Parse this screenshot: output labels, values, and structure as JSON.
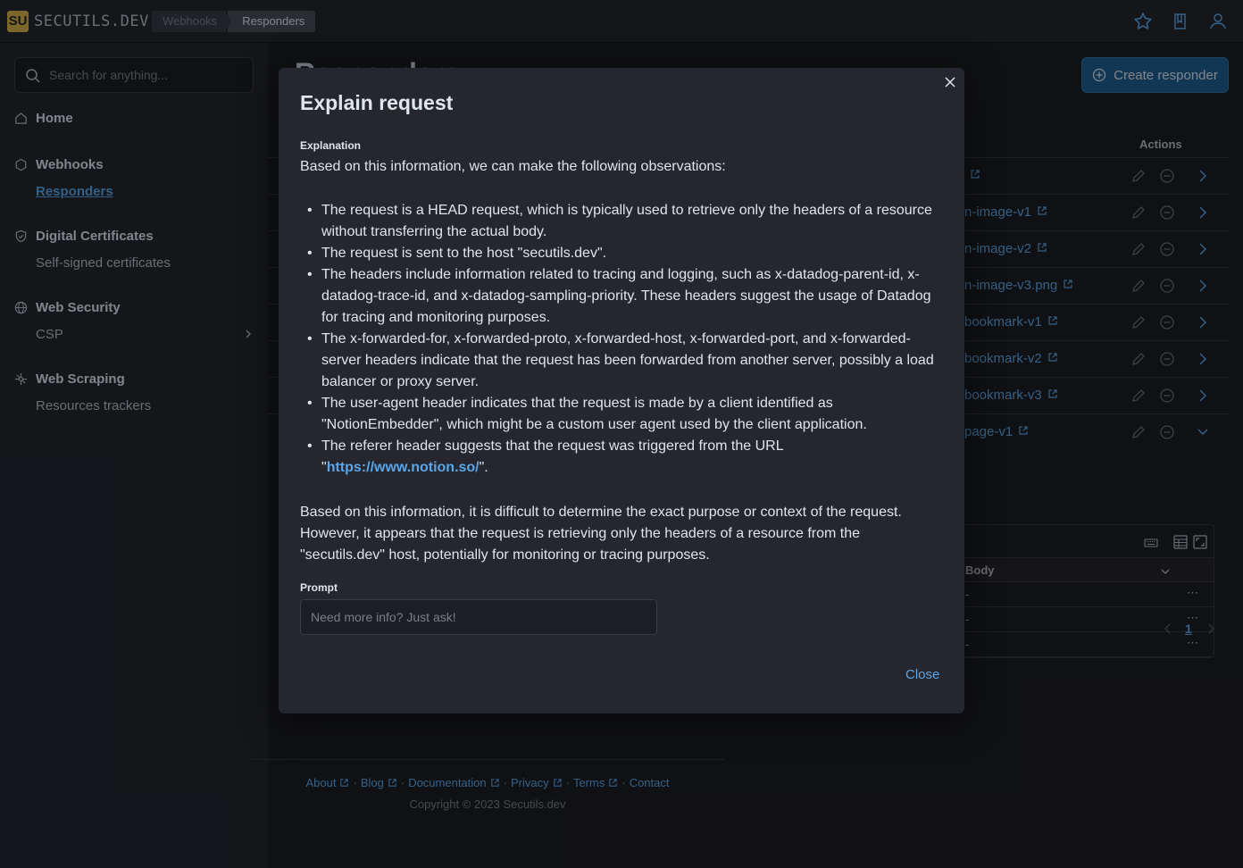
{
  "topbar": {
    "logo_badge": "SU",
    "logo_text": "SECUTILS.DEV",
    "breadcrumbs": [
      "Webhooks",
      "Responders"
    ],
    "icons": [
      "star-icon",
      "book-icon",
      "user-icon"
    ]
  },
  "sidebar": {
    "search_placeholder": "Search for anything...",
    "home": "Home",
    "webhooks": "Webhooks",
    "responders": "Responders",
    "digital_certificates": "Digital Certificates",
    "self_signed": "Self-signed certificates",
    "web_security": "Web Security",
    "csp": "CSP",
    "web_scraping": "Web Scraping",
    "resources_trackers": "Resources trackers"
  },
  "main": {
    "page_title": "Responders",
    "create_button": "Create responder",
    "actions_header": "Actions",
    "rows": [
      {
        "name": ""
      },
      {
        "name": "n-image-v1"
      },
      {
        "name": "n-image-v2"
      },
      {
        "name": "n-image-v3.png"
      },
      {
        "name": "bookmark-v1"
      },
      {
        "name": "bookmark-v2"
      },
      {
        "name": "bookmark-v3"
      },
      {
        "name": "page-v1"
      }
    ],
    "sub_table": {
      "header": "Body",
      "rows": [
        "-",
        "-",
        "-"
      ]
    },
    "pager_current": "1"
  },
  "footer": {
    "links": [
      "About",
      "Blog",
      "Documentation",
      "Privacy",
      "Terms",
      "Contact"
    ],
    "copyright": "Copyright © 2023 Secutils.dev"
  },
  "modal": {
    "title": "Explain request",
    "explanation_label": "Explanation",
    "intro": "Based on this information, we can make the following observations:",
    "bullets": [
      "The request is a HEAD request, which is typically used to retrieve only the headers of a resource without transferring the actual body.",
      "The request is sent to the host \"secutils.dev\".",
      "The headers include information related to tracing and logging, such as x-datadog-parent-id, x-datadog-trace-id, and x-datadog-sampling-priority. These headers suggest the usage of Datadog for tracing and monitoring purposes.",
      "The x-forwarded-for, x-forwarded-proto, x-forwarded-host, x-forwarded-port, and x-forwarded-server headers indicate that the request has been forwarded from another server, possibly a load balancer or proxy server.",
      "The user-agent header indicates that the request is made by a client identified as \"NotionEmbedder\", which might be a custom user agent used by the client application.",
      "The referer header suggests that the request was triggered from the URL"
    ],
    "referer_link": "https://www.notion.so/",
    "conclusion": "Based on this information, it is difficult to determine the exact purpose or context of the request. However, it appears that the request is retrieving only the headers of a resource from the \"secutils.dev\" host, potentially for monitoring or tracing purposes.",
    "prompt_label": "Prompt",
    "prompt_placeholder": "Need more info? Just ask!",
    "close_button": "Close"
  }
}
